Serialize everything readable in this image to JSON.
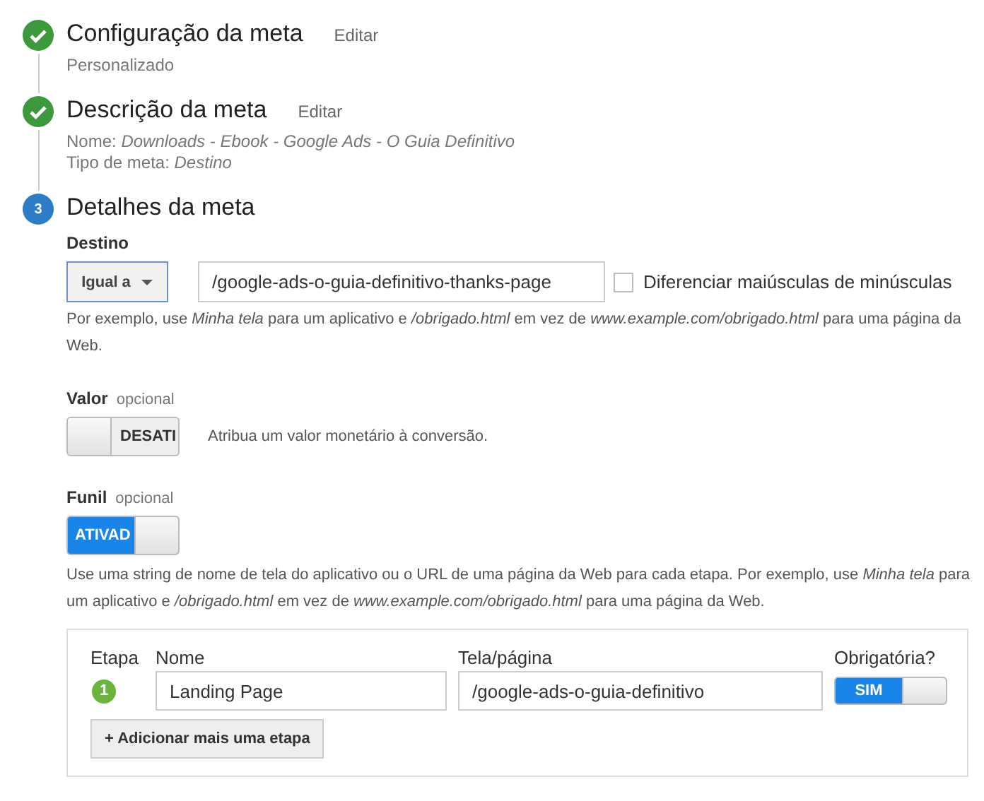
{
  "steps": [
    {
      "title": "Configuração da meta",
      "edit_link": "Editar",
      "done": true,
      "details": [
        "Personalizado"
      ]
    },
    {
      "title": "Descrição da meta",
      "edit_link": "Editar",
      "done": true,
      "details": [
        "Nome: *Downloads - Ebook - Google Ads - O Guia Definitivo*",
        "Tipo de meta: *Destino*"
      ]
    },
    {
      "title": "Detalhes da meta",
      "number": "3",
      "done": false
    }
  ],
  "destination": {
    "label": "Destino",
    "match": "Igual a",
    "value": "/google-ads-o-guia-definitivo-thanks-page",
    "case_checkbox": {
      "label": "Diferenciar maiúsculas de minúsculas",
      "checked": false
    },
    "hint": "Por exemplo, use *Minha tela* para um aplicativo e */obrigado.html* em vez de *www.example.com/obrigado.html* para uma página da Web."
  },
  "value": {
    "label": "Valor",
    "optional": "opcional",
    "toggle": {
      "on": false,
      "label": "DESATI"
    },
    "description": "Atribua um valor monetário à conversão."
  },
  "funnel": {
    "label": "Funil",
    "optional": "opcional",
    "toggle": {
      "on": true,
      "label": "ATIVAD"
    },
    "hint": "Use uma string de nome de tela do aplicativo ou o URL de uma página da Web para cada etapa. Por exemplo, use *Minha tela* para um aplicativo e */obrigado.html* em vez de *www.example.com/obrigado.html* para uma página da Web.",
    "columns": [
      "Etapa",
      "Nome",
      "Tela/página",
      "Obrigatória?"
    ],
    "rows": [
      {
        "number": "1",
        "name": "Landing Page",
        "screen": "/google-ads-o-guia-definitivo",
        "required": {
          "on": true,
          "label": "SIM"
        }
      }
    ],
    "add_button": "+ Adicionar mais uma etapa"
  }
}
